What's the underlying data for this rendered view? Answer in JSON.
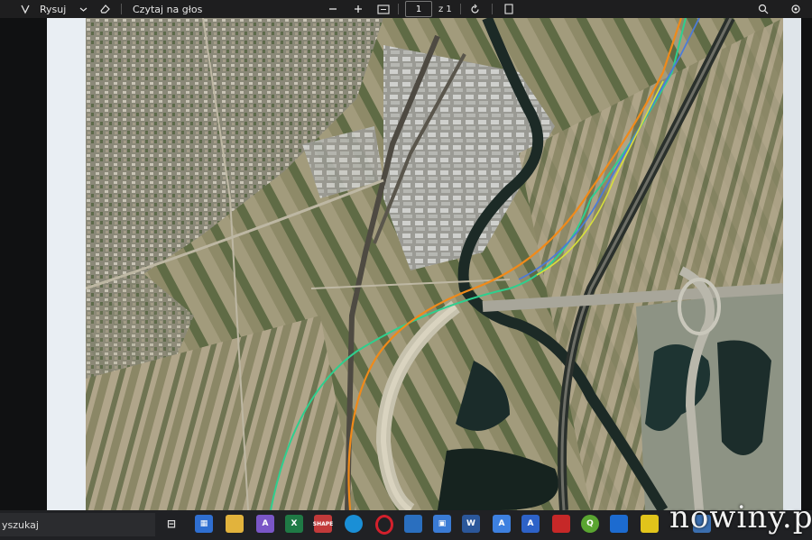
{
  "toolbar": {
    "draw_label": "Rysuj",
    "read_aloud_label": "Czytaj na głos",
    "page_current": "1",
    "page_total": "z 1",
    "icons": [
      "draw-icon",
      "chevron-down-icon",
      "eraser-icon",
      "minus-icon",
      "plus-icon",
      "fit-page-icon",
      "rotate-icon",
      "two-page-icon",
      "search-icon",
      "settings-icon"
    ]
  },
  "map": {
    "route_colors": {
      "green": "#2fcf8e",
      "orange": "#f08a1a",
      "blue": "#4c7bd8",
      "yellow": "#d8e03a"
    }
  },
  "taskbar": {
    "search_label": "yszukaj",
    "apps": [
      {
        "name": "task-view",
        "color": "#3a3a3a"
      },
      {
        "name": "start-menu",
        "color": "#2f6fd1"
      },
      {
        "name": "file-explorer",
        "color": "#e2b33c"
      },
      {
        "name": "app-a",
        "color": "#7a56c7"
      },
      {
        "name": "excel",
        "color": "#1f7a45"
      },
      {
        "name": "shape",
        "color": "#c23a3a",
        "label": "SHAPE"
      },
      {
        "name": "edge",
        "color": "#1a8fd6"
      },
      {
        "name": "opera",
        "color": "#d3202c"
      },
      {
        "name": "app-b",
        "color": "#2a6fbf"
      },
      {
        "name": "save",
        "color": "#3a7bd5"
      },
      {
        "name": "word",
        "color": "#2b579a"
      },
      {
        "name": "font-a",
        "color": "#3d80e0"
      },
      {
        "name": "font-a2",
        "color": "#2d62c8"
      },
      {
        "name": "app-c",
        "color": "#c62828"
      },
      {
        "name": "qgis",
        "color": "#5aa531"
      },
      {
        "name": "app-d",
        "color": "#1c6bd0"
      },
      {
        "name": "app-e",
        "color": "#e1c41b"
      },
      {
        "name": "app-f",
        "color": "#3b6fb0"
      }
    ]
  },
  "watermark": "nowiny.pl"
}
